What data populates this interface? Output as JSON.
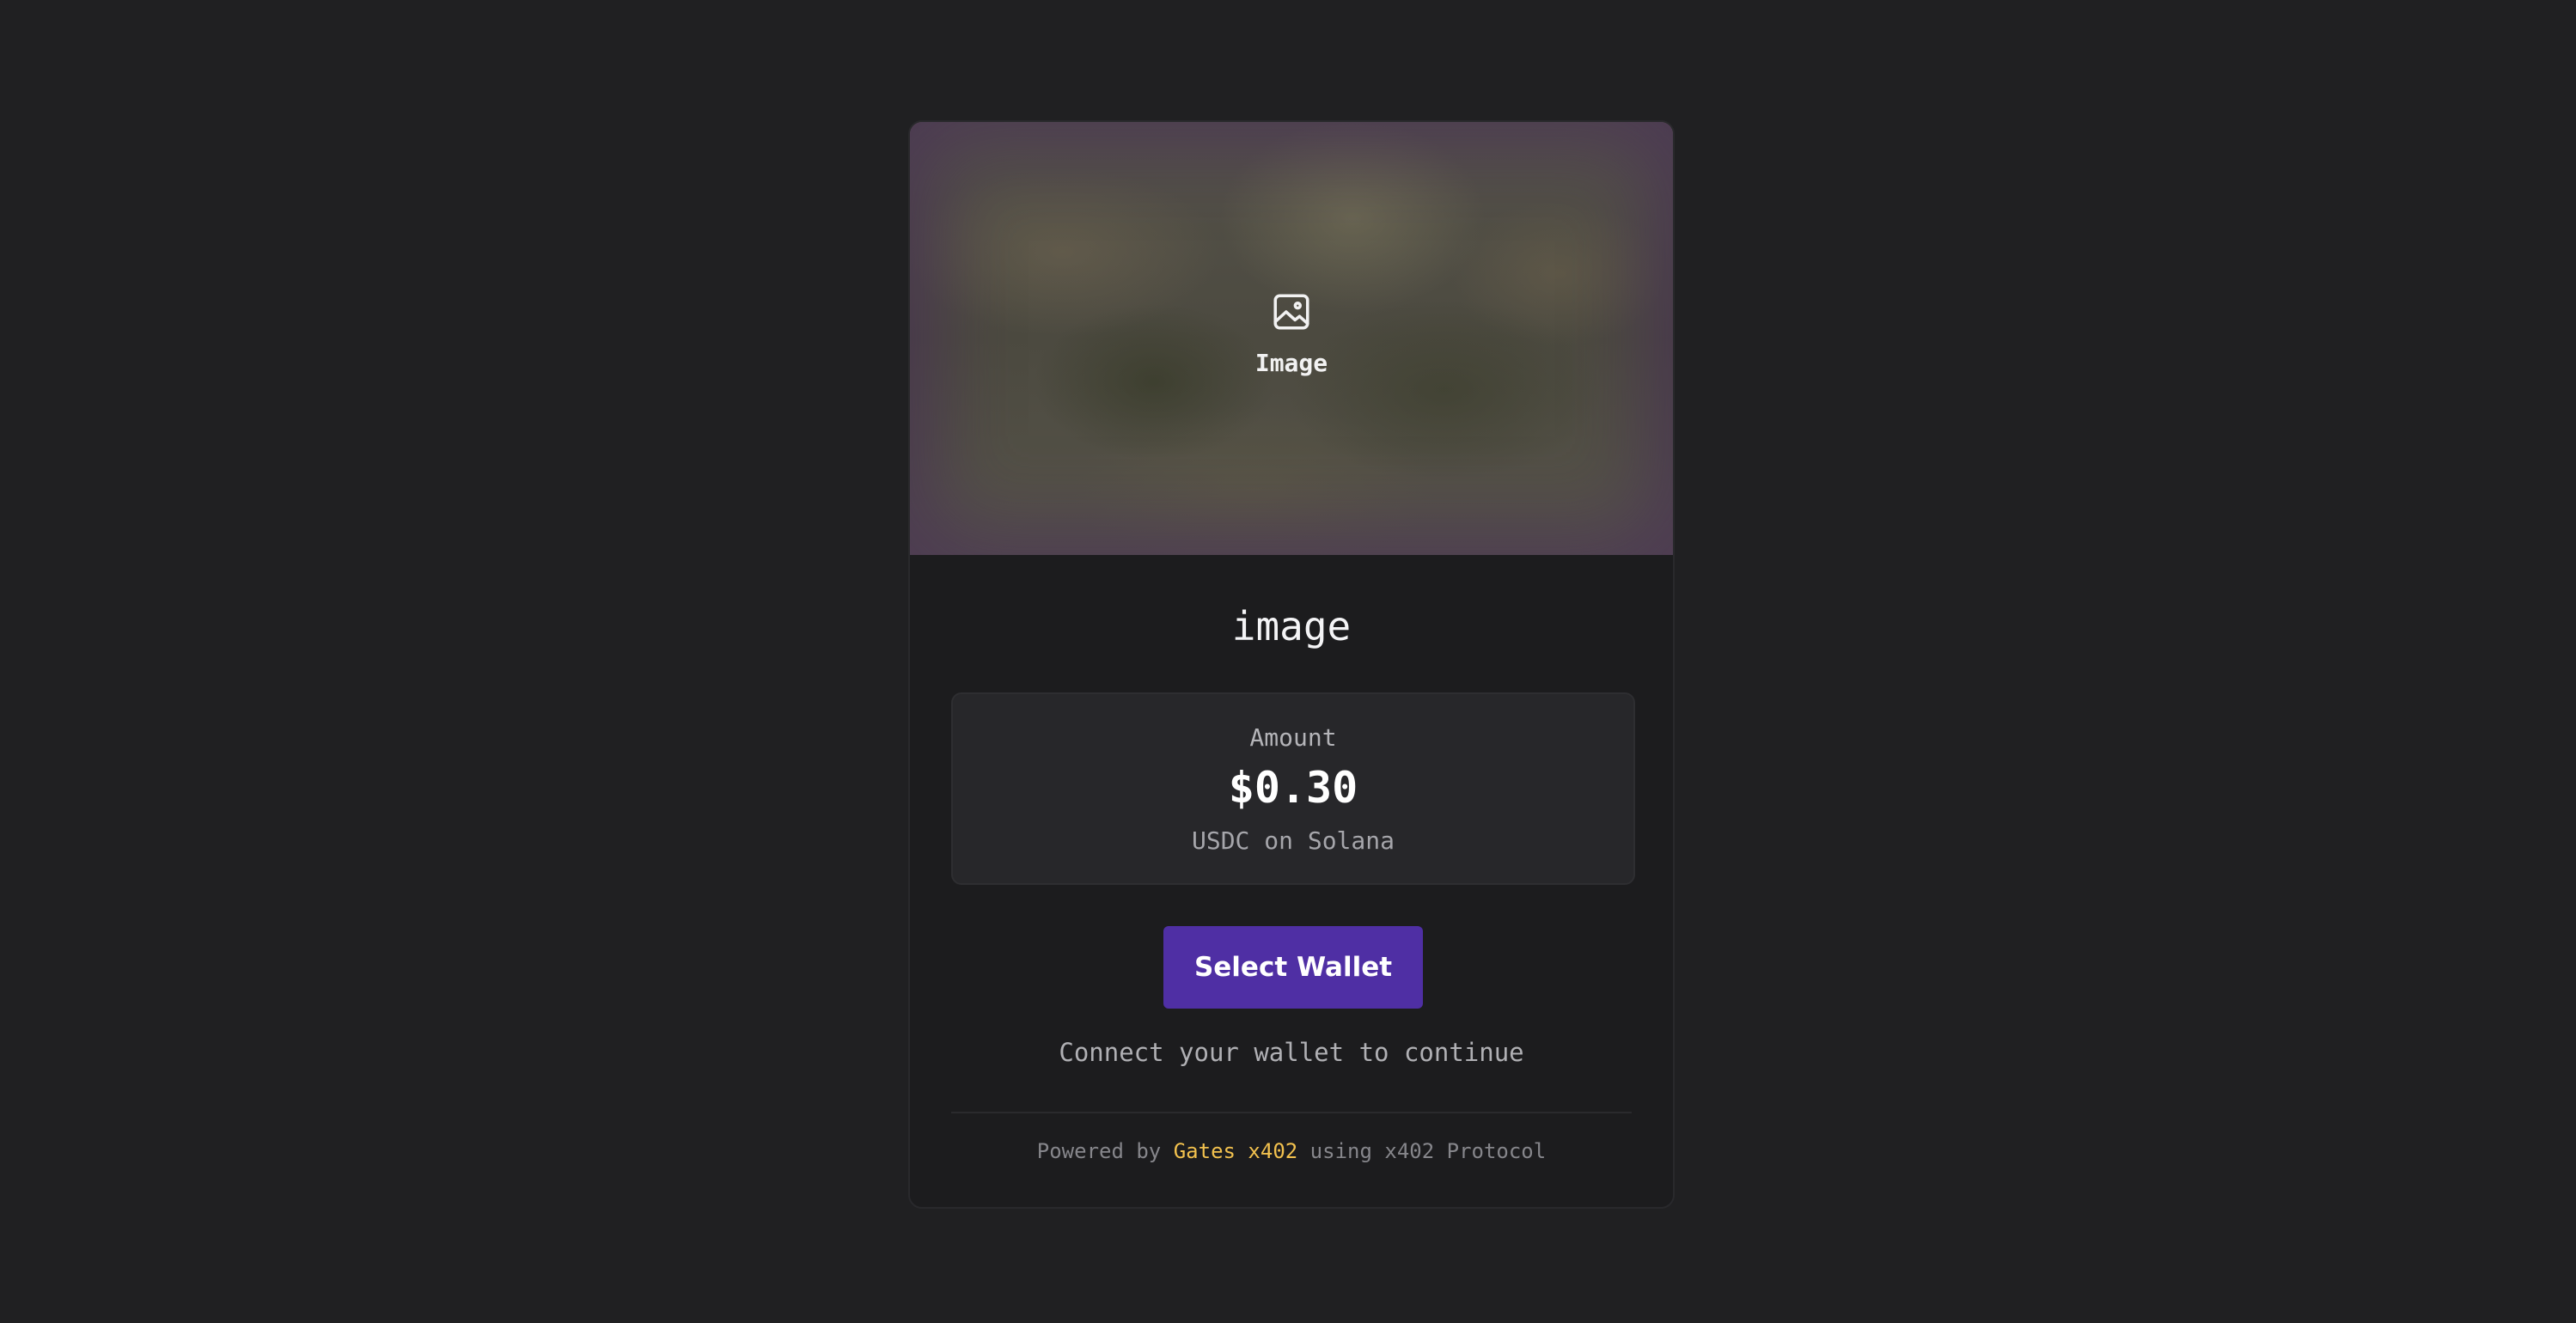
{
  "preview": {
    "icon": "image-icon",
    "label": "Image"
  },
  "title": "image",
  "amount": {
    "label": "Amount",
    "value": "$0.30",
    "currency": "USDC on Solana"
  },
  "wallet_button": {
    "label": "Select Wallet",
    "color": "#4f2fa4"
  },
  "connect_hint": "Connect your wallet to continue",
  "footer": {
    "prefix": "Powered by",
    "brand": "Gates x402",
    "brand_color": "#f2c14e",
    "suffix": "using x402 Protocol"
  }
}
